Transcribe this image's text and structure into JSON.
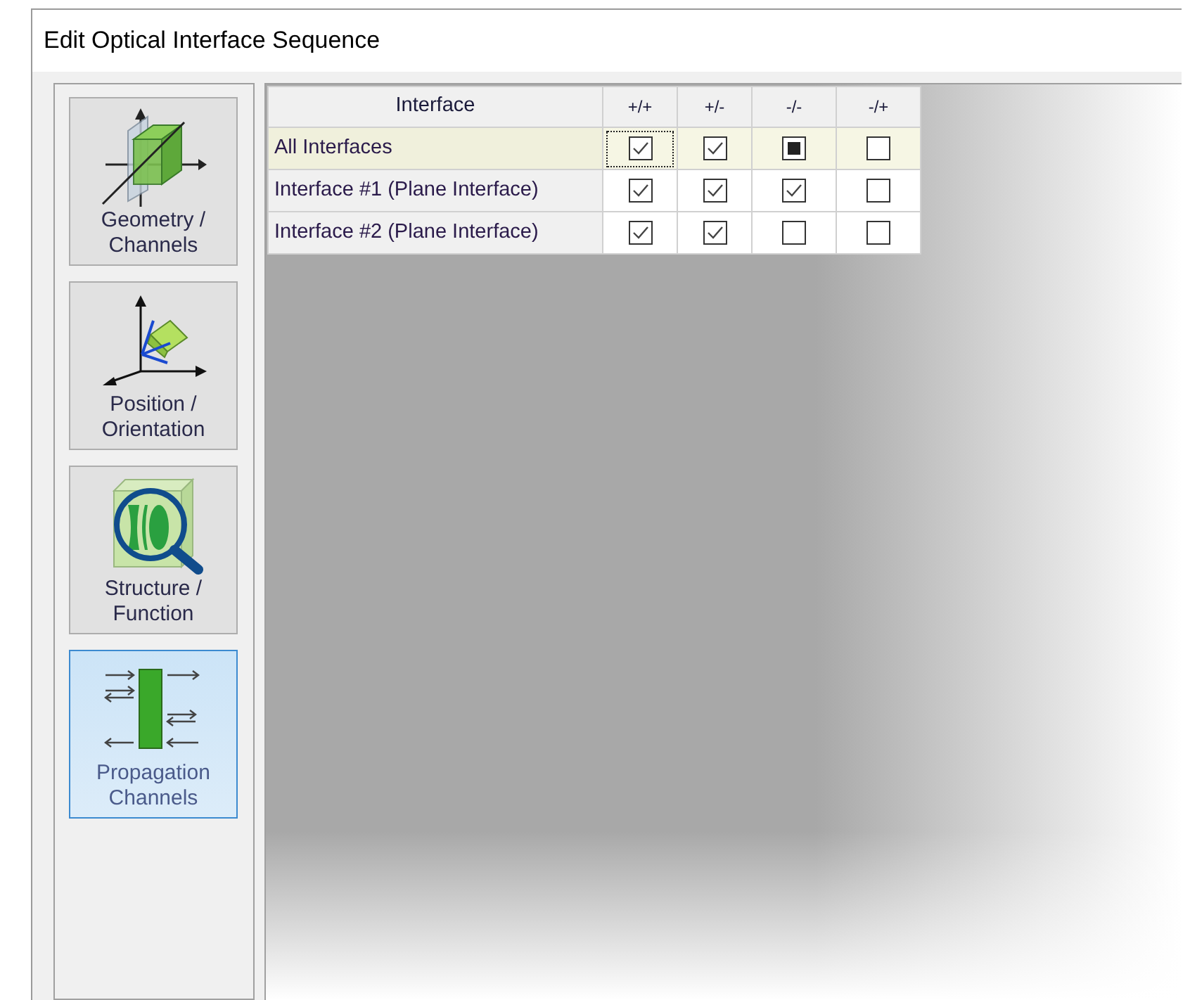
{
  "window": {
    "title": "Edit Optical Interface Sequence"
  },
  "sidebar": {
    "items": [
      {
        "kind": "geometry",
        "label": "Geometry / Channels",
        "selected": false
      },
      {
        "kind": "position",
        "label": "Position / Orientation",
        "selected": false
      },
      {
        "kind": "structure",
        "label": "Structure / Function",
        "selected": false
      },
      {
        "kind": "propagation",
        "label": "Propagation Channels",
        "selected": true
      }
    ]
  },
  "table": {
    "columns": [
      "Interface",
      "+/+",
      "+/-",
      "-/-",
      "-/+"
    ],
    "rows": [
      {
        "name": "All Interfaces",
        "selected": true,
        "cells": [
          {
            "checked": true,
            "mixed": false,
            "focused": true
          },
          {
            "checked": true,
            "mixed": false,
            "focused": false
          },
          {
            "checked": false,
            "mixed": true,
            "focused": false
          },
          {
            "checked": false,
            "mixed": false,
            "focused": false
          }
        ]
      },
      {
        "name": "Interface #1 (Plane Interface)",
        "selected": false,
        "cells": [
          {
            "checked": true,
            "mixed": false,
            "focused": false
          },
          {
            "checked": true,
            "mixed": false,
            "focused": false
          },
          {
            "checked": true,
            "mixed": false,
            "focused": false
          },
          {
            "checked": false,
            "mixed": false,
            "focused": false
          }
        ]
      },
      {
        "name": "Interface #2 (Plane Interface)",
        "selected": false,
        "cells": [
          {
            "checked": true,
            "mixed": false,
            "focused": false
          },
          {
            "checked": true,
            "mixed": false,
            "focused": false
          },
          {
            "checked": false,
            "mixed": false,
            "focused": false
          },
          {
            "checked": false,
            "mixed": false,
            "focused": false
          }
        ]
      }
    ]
  }
}
